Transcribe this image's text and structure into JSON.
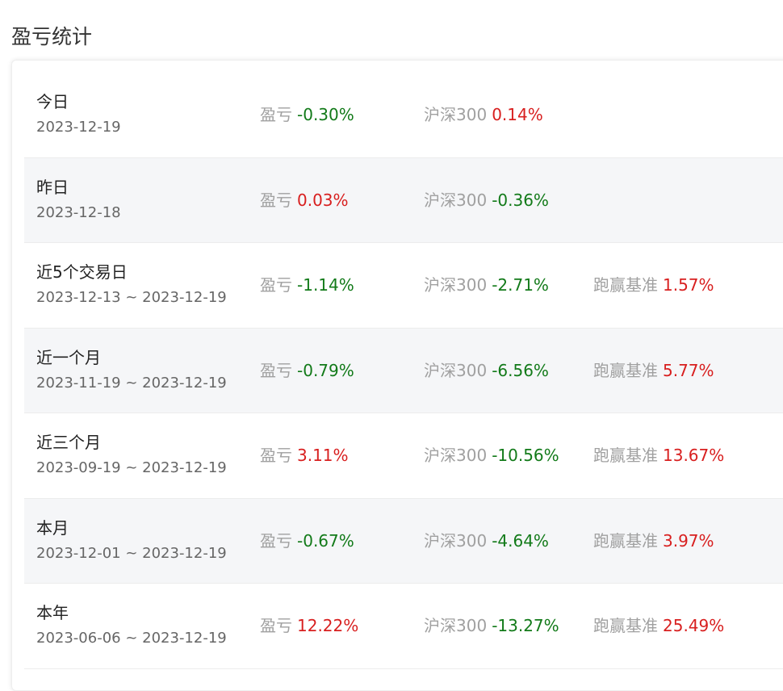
{
  "page_title": "盈亏统计",
  "colors": {
    "positive": "#d81f1f",
    "negative": "#127a19",
    "label": "#a0a0a0"
  },
  "labels": {
    "pnl": "盈亏",
    "benchmark": "沪深300",
    "excess": "跑赢基准"
  },
  "rows": [
    {
      "period": "今日",
      "date": "2023-12-19",
      "pnl": "-0.30%",
      "pnl_dir": "neg",
      "benchmark": "0.14%",
      "benchmark_dir": "pos",
      "excess": null,
      "excess_dir": null
    },
    {
      "period": "昨日",
      "date": "2023-12-18",
      "pnl": "0.03%",
      "pnl_dir": "pos",
      "benchmark": "-0.36%",
      "benchmark_dir": "neg",
      "excess": null,
      "excess_dir": null
    },
    {
      "period": "近5个交易日",
      "date": "2023-12-13 ~ 2023-12-19",
      "pnl": "-1.14%",
      "pnl_dir": "neg",
      "benchmark": "-2.71%",
      "benchmark_dir": "neg",
      "excess": "1.57%",
      "excess_dir": "pos"
    },
    {
      "period": "近一个月",
      "date": "2023-11-19 ~ 2023-12-19",
      "pnl": "-0.79%",
      "pnl_dir": "neg",
      "benchmark": "-6.56%",
      "benchmark_dir": "neg",
      "excess": "5.77%",
      "excess_dir": "pos"
    },
    {
      "period": "近三个月",
      "date": "2023-09-19 ~ 2023-12-19",
      "pnl": "3.11%",
      "pnl_dir": "pos",
      "benchmark": "-10.56%",
      "benchmark_dir": "neg",
      "excess": "13.67%",
      "excess_dir": "pos"
    },
    {
      "period": "本月",
      "date": "2023-12-01 ~ 2023-12-19",
      "pnl": "-0.67%",
      "pnl_dir": "neg",
      "benchmark": "-4.64%",
      "benchmark_dir": "neg",
      "excess": "3.97%",
      "excess_dir": "pos"
    },
    {
      "period": "本年",
      "date": "2023-06-06 ~ 2023-12-19",
      "pnl": "12.22%",
      "pnl_dir": "pos",
      "benchmark": "-13.27%",
      "benchmark_dir": "neg",
      "excess": "25.49%",
      "excess_dir": "pos"
    }
  ]
}
